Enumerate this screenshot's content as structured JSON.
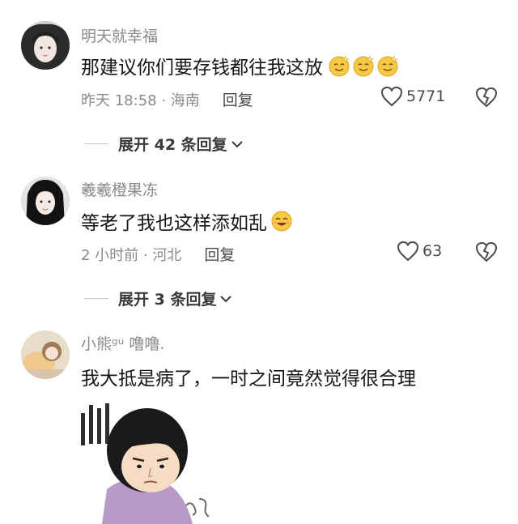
{
  "comments": [
    {
      "username": "明天就幸福",
      "text": "那建议你们要存钱都往我这放",
      "emoji": [
        "smile-sparkle-emoji",
        "smile-sparkle-emoji",
        "smile-sparkle-emoji"
      ],
      "time_location": "昨天 18:58 · 海南",
      "reply_label": "回复",
      "likes": "5771",
      "expand_label": "展开 42 条回复"
    },
    {
      "username": "羲羲橙果冻",
      "text": "等老了我也这样添如乱",
      "emoji": [
        "grin-emoji"
      ],
      "time_location": "2 小时前 · 河北",
      "reply_label": "回复",
      "likes": "63",
      "expand_label": "展开 3 条回复"
    },
    {
      "username": "小熊ᵍᵘ 噜噜.",
      "text": "我大抵是病了，一时之间竟然觉得很合理",
      "sticker": "cartoon-sticker"
    }
  ],
  "colors": {
    "meta_gray": "#8a8a8a",
    "text_dark": "#161616",
    "emoji_yellow": "#f7c843"
  }
}
